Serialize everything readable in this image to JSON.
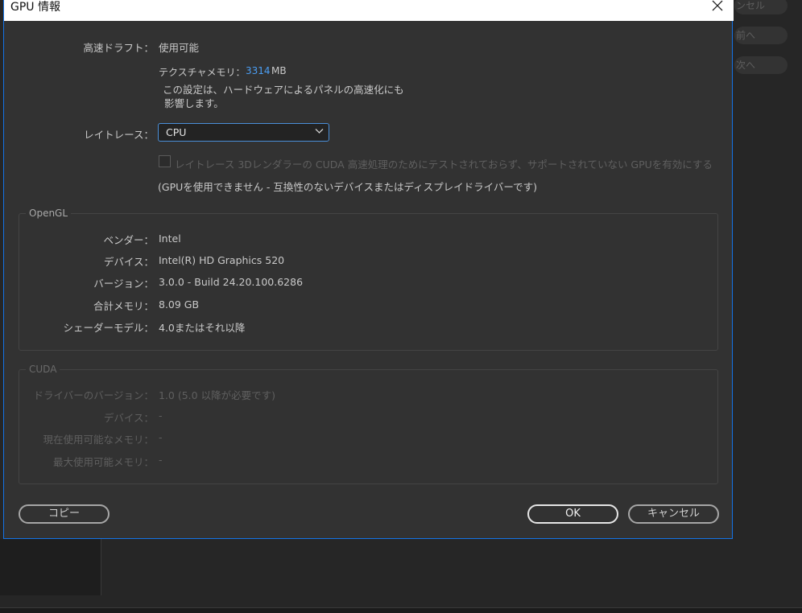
{
  "background": {
    "buttons": [
      "ンセル",
      "前へ",
      "次へ"
    ]
  },
  "dialog": {
    "title": "GPU 情報",
    "draft": {
      "label": "高速ドラフト：",
      "value": "使用可能",
      "texture_label": "テクスチャメモリ：",
      "texture_value": "3314",
      "texture_unit": "MB",
      "note_line1": "この設定は、ハードウェアによるパネルの高速化にも",
      "note_line2": "影響します。"
    },
    "raytrace": {
      "label": "レイトレース：",
      "selected": "CPU",
      "checkbox_label": "レイトレース 3Dレンダラーの CUDA 高速処理のためにテストされておらず、サポートされていない GPUを有効にする",
      "checkbox_checked": false,
      "status": "(GPUを使用できません - 互換性のないデバイスまたはディスプレイドライバーです)"
    },
    "opengl": {
      "title": "OpenGL",
      "rows": [
        {
          "label": "ベンダー：",
          "value": "Intel"
        },
        {
          "label": "デバイス：",
          "value": "Intel(R) HD Graphics 520"
        },
        {
          "label": "バージョン：",
          "value": "3.0.0 - Build 24.20.100.6286"
        },
        {
          "label": "合計メモリ：",
          "value": "8.09 GB"
        },
        {
          "label": "シェーダーモデル：",
          "value": "4.0またはそれ以降"
        }
      ]
    },
    "cuda": {
      "title": "CUDA",
      "rows": [
        {
          "label": "ドライバーのバージョン：",
          "value": "1.0 (5.0 以降が必要です)"
        },
        {
          "label": "デバイス：",
          "value": "-"
        },
        {
          "label": "現在使用可能なメモリ：",
          "value": "-"
        },
        {
          "label": "最大使用可能メモリ：",
          "value": "-"
        }
      ]
    },
    "buttons": {
      "copy": "コピー",
      "ok": "OK",
      "cancel": "キャンセル"
    }
  },
  "colors": {
    "accent": "#1473e6",
    "dialog_bg": "#323232",
    "texture_value": "#4b9ff5"
  }
}
